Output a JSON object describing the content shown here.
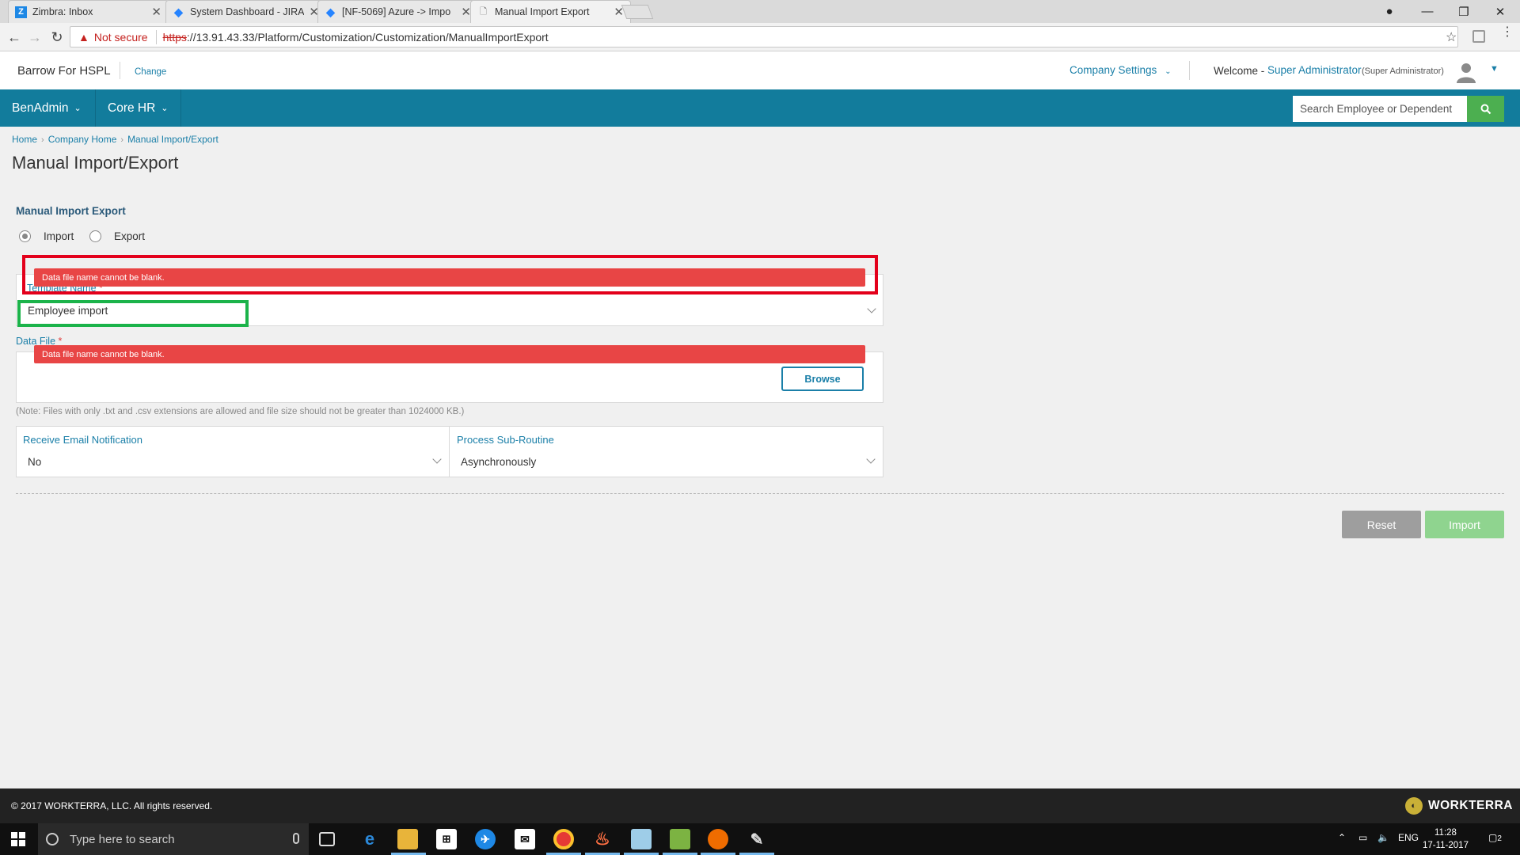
{
  "browser": {
    "tabs": [
      {
        "title": "Zimbra: Inbox",
        "icon": "zimbra-icon"
      },
      {
        "title": "System Dashboard - JIRA",
        "icon": "jira-icon"
      },
      {
        "title": "[NF-5069] Azure -> Impo",
        "icon": "jira-icon"
      },
      {
        "title": "Manual Import Export",
        "icon": "page-icon"
      }
    ],
    "security_label": "Not secure",
    "url_scheme": "https",
    "url_rest": "://13.91.43.33/Platform/Customization/Customization/ManualImportExport"
  },
  "header": {
    "company_name": "Barrow For HSPL",
    "change_label": "Change",
    "company_settings_label": "Company Settings",
    "welcome_label": "Welcome -",
    "user_name": "Super Administrator",
    "user_role": "(Super Administrator)"
  },
  "nav": {
    "items": [
      {
        "label": "BenAdmin"
      },
      {
        "label": "Core HR"
      }
    ],
    "search_placeholder": "Search Employee or Dependent"
  },
  "breadcrumb": [
    "Home",
    "Company Home",
    "Manual Import/Export"
  ],
  "page_title": "Manual Import/Export",
  "form": {
    "section_title": "Manual Import Export",
    "mode_options": [
      {
        "label": "Import",
        "selected": true
      },
      {
        "label": "Export",
        "selected": false
      }
    ],
    "template_label": "Template Name",
    "template_value": "Employee import",
    "template_error": "Data file name cannot be blank.",
    "data_file_label": "Data File",
    "data_file_error": "Data file name cannot be blank.",
    "browse_label": "Browse",
    "note": "(Note: Files with only .txt and .csv extensions are allowed and file size should not be greater than 1024000 KB.)",
    "email_label": "Receive Email Notification",
    "email_value": "No",
    "process_label": "Process Sub-Routine",
    "process_value": "Asynchronously",
    "reset_label": "Reset",
    "import_label": "Import",
    "required_mark": "*"
  },
  "footer": {
    "copyright": "© 2017 WORKTERRA, LLC. All rights reserved.",
    "brand": "WORKTERRA"
  },
  "taskbar": {
    "search_placeholder": "Type here to search",
    "language": "ENG",
    "time": "11:28",
    "date": "17-11-2017",
    "notification_count": "2"
  },
  "colors": {
    "nav_bg": "#127c9c",
    "link": "#1a7fa8",
    "error": "#e84545",
    "highlight_red": "#e3001b",
    "highlight_green": "#1bb34a",
    "reset_bg": "#9e9e9e",
    "import_bg": "#8fd48f",
    "search_btn": "#4caf50"
  }
}
